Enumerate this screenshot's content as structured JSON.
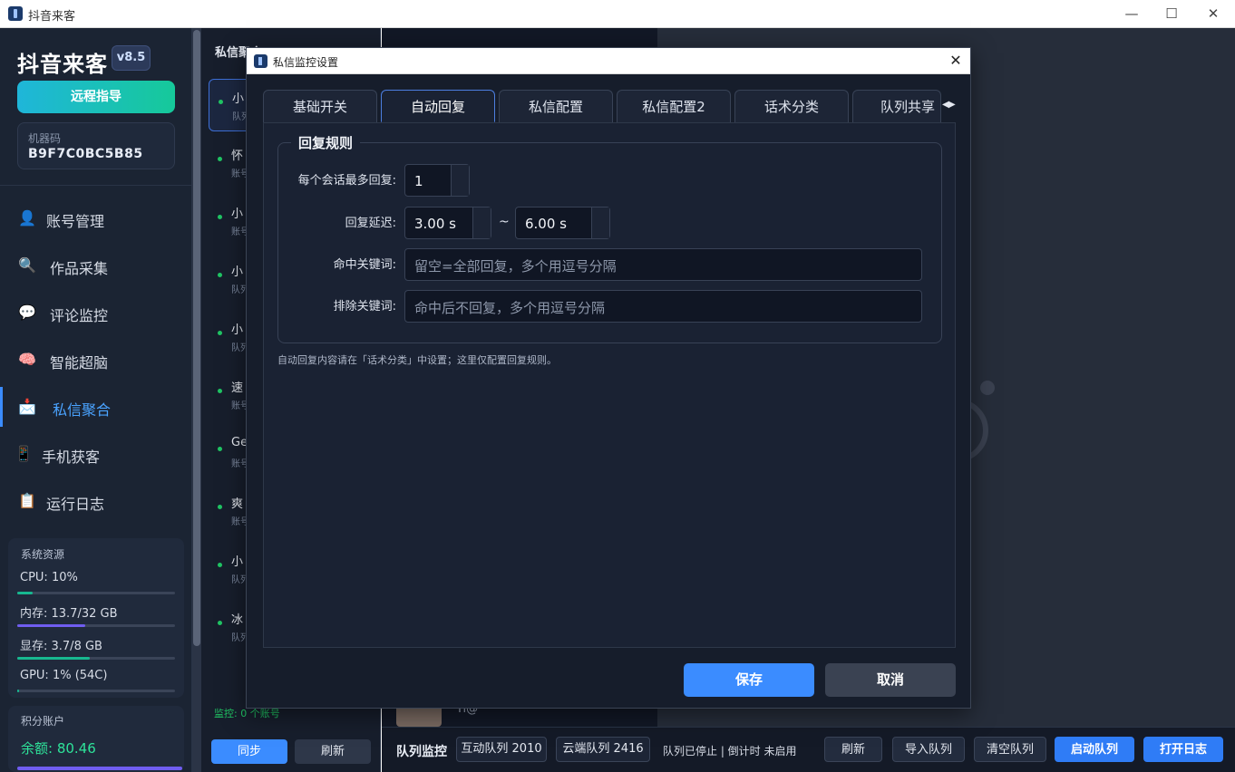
{
  "window": {
    "title": "抖音来客"
  },
  "sidebar": {
    "brand": "抖音来客",
    "version": "v8.5",
    "remote_button": "远程指导",
    "machine_label": "机器码",
    "machine_code": "B9F7C0BC5B85",
    "nav": [
      {
        "label": "账号管理",
        "icon": "user-icon"
      },
      {
        "label": "作品采集",
        "icon": "search-icon"
      },
      {
        "label": "评论监控",
        "icon": "comment-icon"
      },
      {
        "label": "智能超脑",
        "icon": "brain-icon"
      },
      {
        "label": "私信聚合",
        "icon": "mailbox-icon",
        "active": true
      },
      {
        "label": "手机获客",
        "icon": "phone-icon"
      },
      {
        "label": "运行日志",
        "icon": "clipboard-icon"
      }
    ],
    "resources": {
      "title": "系统资源",
      "cpu": "CPU: 10%",
      "cpu_pct": 10,
      "mem": "内存: 13.7/32 GB",
      "mem_pct": 43,
      "vram": "显存: 3.7/8 GB",
      "vram_pct": 46,
      "gpu": "GPU: 1% (54C)",
      "gpu_pct": 1
    },
    "points": {
      "title": "积分账户",
      "balance": "余额: 80.46"
    }
  },
  "conversations": {
    "header": "私信聚合",
    "items": [
      {
        "name": "小",
        "sub": "队列"
      },
      {
        "name": "怀",
        "sub": "账号"
      },
      {
        "name": "小",
        "sub": "账号"
      },
      {
        "name": "小",
        "sub": "队列"
      },
      {
        "name": "小",
        "sub": "队列"
      },
      {
        "name": "速",
        "sub": "账号"
      },
      {
        "name": "Ge",
        "sub": "账号"
      },
      {
        "name": "爽",
        "sub": "账号"
      },
      {
        "name": "小",
        "sub": "队列"
      },
      {
        "name": "冰",
        "sub": "队列"
      }
    ],
    "footer": "监控: 0 个账号",
    "sync_label": "同步",
    "refresh_label": "刷新"
  },
  "chat_peek": {
    "name": "Ti@"
  },
  "queue": {
    "title": "队列监控",
    "interact": "互动队列 2010",
    "cloud": "云端队列 2416",
    "status": "队列已停止 | 倒计时 未启用",
    "refresh": "刷新",
    "import": "导入队列",
    "clear": "清空队列",
    "start": "启动队列",
    "open_log": "打开日志"
  },
  "modal": {
    "title": "私信监控设置",
    "tabs": [
      "基础开关",
      "自动回复",
      "私信配置",
      "私信配置2",
      "话术分类",
      "队列共享"
    ],
    "active_tab": 1,
    "group_title": "回复规则",
    "max_reply_label": "每个会话最多回复:",
    "max_reply_value": "1",
    "delay_label": "回复延迟:",
    "delay_min": "3.00 s",
    "delay_sep": "~",
    "delay_max": "6.00 s",
    "hit_keyword_label": "命中关键词:",
    "hit_keyword_placeholder": "留空=全部回复，多个用逗号分隔",
    "exclude_keyword_label": "排除关键词:",
    "exclude_keyword_placeholder": "命中后不回复，多个用逗号分隔",
    "hint": "自动回复内容请在「话术分类」中设置；这里仅配置回复规则。",
    "save": "保存",
    "cancel": "取消"
  },
  "colors": {
    "accent": "#3b8cff",
    "success": "#20c463",
    "cpu_bar": "#17b890",
    "mem_bar": "#6f5df0",
    "vram_bar": "#17b890"
  }
}
